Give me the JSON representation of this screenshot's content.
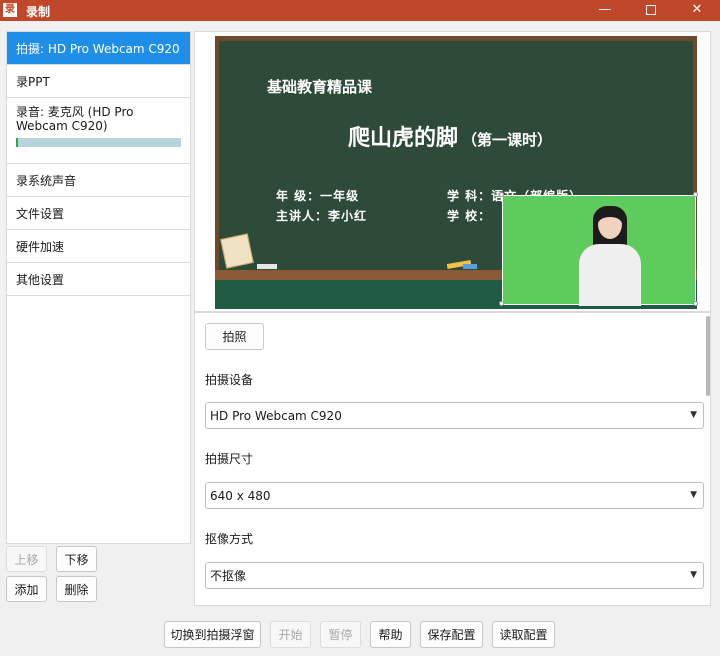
{
  "window": {
    "icon_text": "录",
    "title": "录制",
    "min_symbol": "—",
    "close_symbol": "✕"
  },
  "sidebar": {
    "items": [
      {
        "label": "拍摄: HD Pro Webcam C920",
        "active": true
      },
      {
        "label": "录PPT"
      },
      {
        "label": "录音: 麦克风 (HD Pro Webcam C920)",
        "level": 0.01
      },
      {
        "label": "录系统声音"
      },
      {
        "label": "文件设置"
      },
      {
        "label": "硬件加速"
      },
      {
        "label": "其他设置"
      }
    ],
    "buttons": {
      "up": "上移",
      "down": "下移",
      "add": "添加",
      "delete": "删除"
    }
  },
  "preview": {
    "subtitle": "基础教育精品课",
    "title": "爬山虎的脚",
    "title_suffix": "（第一课时）",
    "grade_line": "年  级：一年级",
    "subject_line": "学  科：语文（部编版）",
    "teacher_line": "主讲人：李小红",
    "school_line": "学  校："
  },
  "settings": {
    "snapshot_button": "拍照",
    "device_label": "拍摄设备",
    "device_value": "HD Pro Webcam C920",
    "size_label": "拍摄尺寸",
    "size_value": "640 x 480",
    "keying_label": "抠像方式",
    "keying_value": "不抠像"
  },
  "footer": {
    "switch_float": "切换到拍摄浮窗",
    "start": "开始",
    "pause": "暂停",
    "help": "帮助",
    "save_config": "保存配置",
    "load_config": "读取配置"
  },
  "colors": {
    "titlebar": "#c0472a",
    "active": "#1e8ee6",
    "chalkboard": "#2e4a38",
    "greenscreen": "#5dcc5d"
  }
}
